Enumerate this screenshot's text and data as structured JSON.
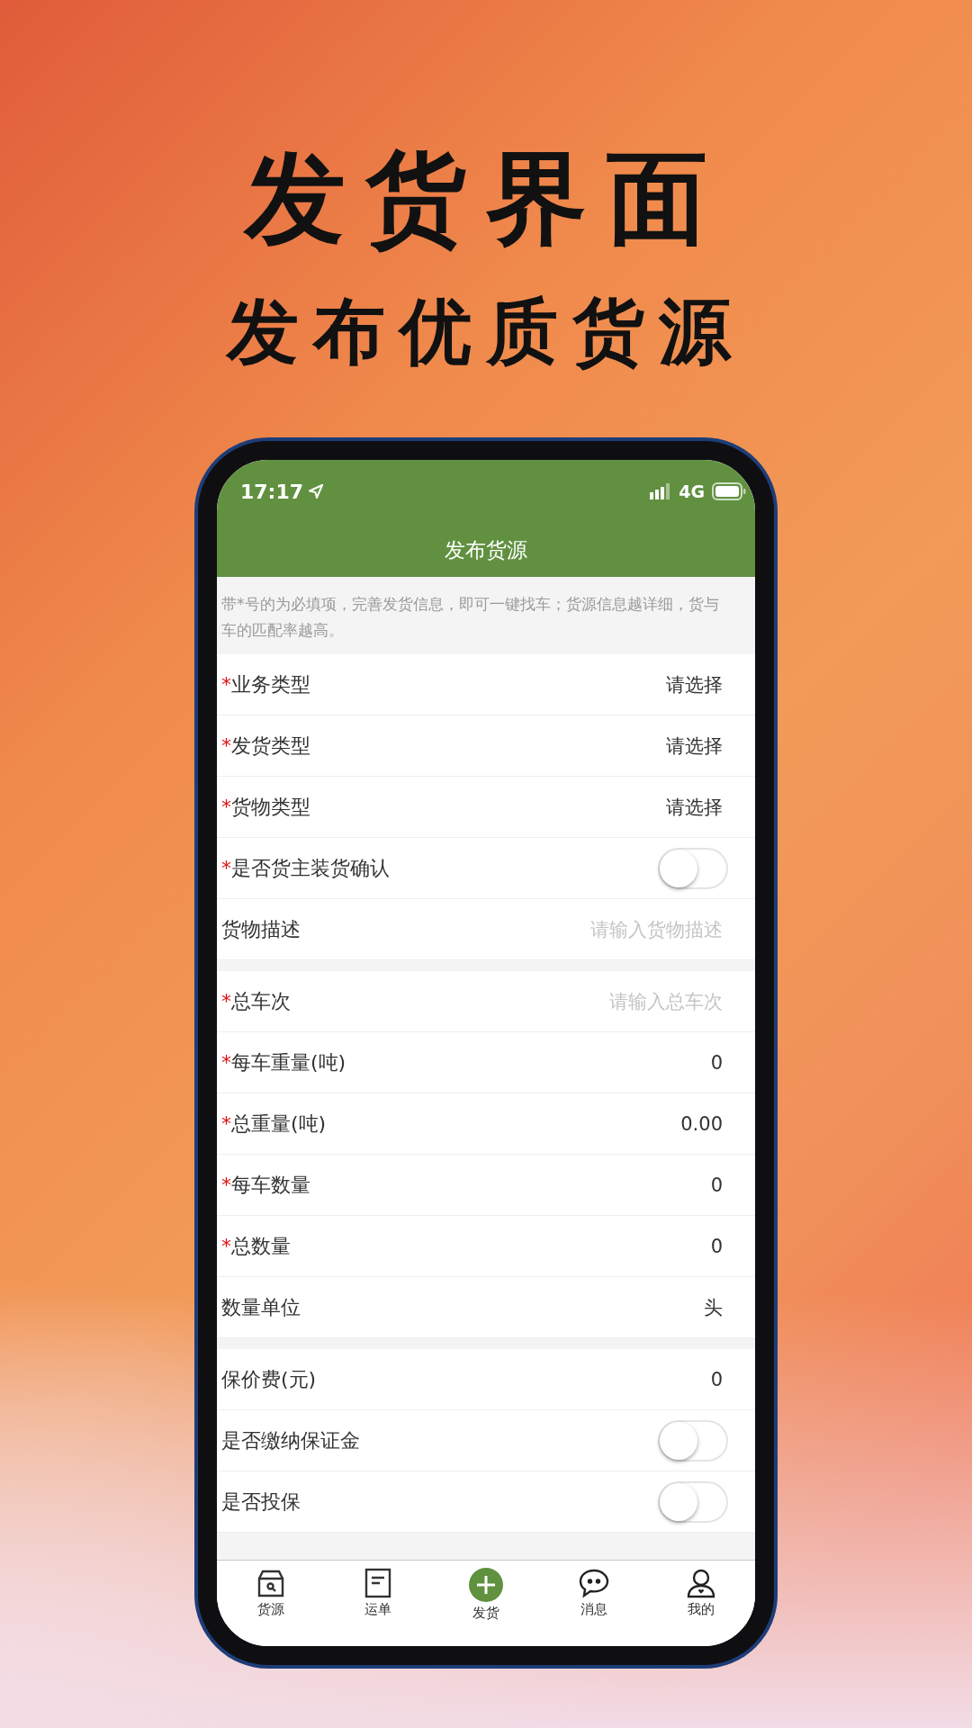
{
  "headline": {
    "title": "发货界面",
    "subtitle": "发布优质货源"
  },
  "status_bar": {
    "time": "17:17",
    "network": "4G"
  },
  "nav_bar": {
    "title": "发布货源"
  },
  "notice": "带*号的为必填项，完善发货信息，即可一键找车；货源信息越详细，货与车的匹配率越高。",
  "required_mark": "*",
  "sections": [
    {
      "rows": [
        {
          "kind": "select",
          "label": "业务类型",
          "required": true,
          "value": "请选择"
        },
        {
          "kind": "select",
          "label": "发货类型",
          "required": true,
          "value": "请选择"
        },
        {
          "kind": "select",
          "label": "货物类型",
          "required": true,
          "value": "请选择"
        },
        {
          "kind": "toggle",
          "label": "是否货主装货确认",
          "required": true,
          "on": false
        },
        {
          "kind": "input",
          "label": "货物描述",
          "required": false,
          "placeholder": "请输入货物描述"
        }
      ]
    },
    {
      "rows": [
        {
          "kind": "input",
          "label": "总车次",
          "required": true,
          "placeholder": "请输入总车次"
        },
        {
          "kind": "input",
          "label": "每车重量(吨)",
          "required": true,
          "value": "0"
        },
        {
          "kind": "input",
          "label": "总重量(吨)",
          "required": true,
          "value": "0.00"
        },
        {
          "kind": "input",
          "label": "每车数量",
          "required": true,
          "value": "0"
        },
        {
          "kind": "input",
          "label": "总数量",
          "required": true,
          "value": "0"
        },
        {
          "kind": "select",
          "label": "数量单位",
          "required": false,
          "value": "头"
        }
      ]
    },
    {
      "rows": [
        {
          "kind": "input",
          "label": "保价费(元)",
          "required": false,
          "value": "0"
        },
        {
          "kind": "toggle",
          "label": "是否缴纳保证金",
          "required": false,
          "on": false
        },
        {
          "kind": "toggle",
          "label": "是否投保",
          "required": false,
          "on": false
        }
      ]
    }
  ],
  "tab_bar": [
    {
      "label": "货源"
    },
    {
      "label": "运单"
    },
    {
      "label": "发货"
    },
    {
      "label": "消息"
    },
    {
      "label": "我的"
    }
  ]
}
